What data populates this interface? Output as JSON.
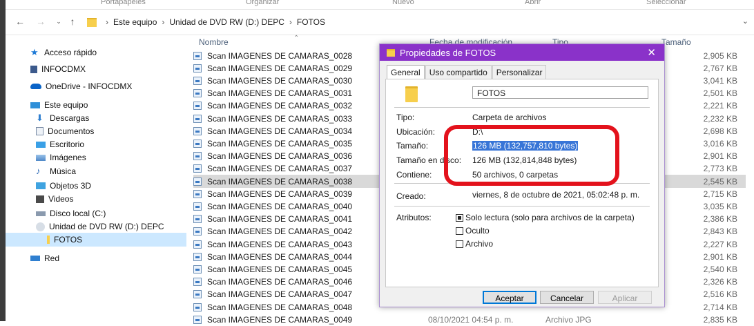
{
  "ribbon": [
    "Portapapeles",
    "Organizar",
    "Nuevo",
    "Abrir",
    "Seleccionar"
  ],
  "address": {
    "crumbs": [
      "Este equipo",
      "Unidad de DVD RW (D:) DEPC",
      "FOTOS"
    ]
  },
  "nav": [
    {
      "label": "Acceso rápido",
      "icon": "star-icon",
      "color": "#1e7ad6"
    },
    {
      "label": "INFOCDMX",
      "icon": "building-icon",
      "color": "#3c5a8c"
    },
    {
      "label": "OneDrive - INFOCDMX",
      "icon": "cloud-icon",
      "color": "#0a64c8"
    },
    {
      "label": "Este equipo",
      "icon": "computer-icon",
      "color": "#2f8fd8"
    },
    {
      "label": "Descargas",
      "icon": "download-icon",
      "color": "#2f7fd0"
    },
    {
      "label": "Documentos",
      "icon": "documents-icon",
      "color": "#7a8ca6"
    },
    {
      "label": "Escritorio",
      "icon": "desktop-icon",
      "color": "#3aa0e6"
    },
    {
      "label": "Imágenes",
      "icon": "pictures-icon",
      "color": "#4f88c8"
    },
    {
      "label": "Música",
      "icon": "music-icon",
      "color": "#1f5fb0"
    },
    {
      "label": "Objetos 3D",
      "icon": "objects-3d-icon",
      "color": "#3fa3e0"
    },
    {
      "label": "Videos",
      "icon": "videos-icon",
      "color": "#4a4a4a"
    },
    {
      "label": "Disco local (C:)",
      "icon": "disk-icon",
      "color": "#8a9aae"
    },
    {
      "label": "Unidad de DVD RW (D:) DEPC",
      "icon": "dvd-icon",
      "color": "#b9c4cf"
    },
    {
      "label": "FOTOS",
      "icon": "folder-icon",
      "color": "#f7cf4d"
    },
    {
      "label": "Red",
      "icon": "network-icon",
      "color": "#2f7fd0"
    }
  ],
  "list": {
    "columns": {
      "name": "Nombre",
      "date": "Fecha de modificación",
      "type": "Tipo",
      "size": "Tamaño"
    },
    "rows": [
      {
        "name": "Scan IMAGENES DE CAMARAS_0028",
        "size": "2,905 KB"
      },
      {
        "name": "Scan IMAGENES DE CAMARAS_0029",
        "size": "2,767 KB"
      },
      {
        "name": "Scan IMAGENES DE CAMARAS_0030",
        "size": "3,041 KB"
      },
      {
        "name": "Scan IMAGENES DE CAMARAS_0031",
        "size": "2,501 KB"
      },
      {
        "name": "Scan IMAGENES DE CAMARAS_0032",
        "size": "2,221 KB"
      },
      {
        "name": "Scan IMAGENES DE CAMARAS_0033",
        "size": "2,232 KB"
      },
      {
        "name": "Scan IMAGENES DE CAMARAS_0034",
        "size": "2,698 KB"
      },
      {
        "name": "Scan IMAGENES DE CAMARAS_0035",
        "size": "3,016 KB"
      },
      {
        "name": "Scan IMAGENES DE CAMARAS_0036",
        "size": "2,901 KB"
      },
      {
        "name": "Scan IMAGENES DE CAMARAS_0037",
        "size": "2,773 KB"
      },
      {
        "name": "Scan IMAGENES DE CAMARAS_0038",
        "size": "2,545 KB",
        "highlight": true
      },
      {
        "name": "Scan IMAGENES DE CAMARAS_0039",
        "size": "2,715 KB"
      },
      {
        "name": "Scan IMAGENES DE CAMARAS_0040",
        "size": "3,035 KB"
      },
      {
        "name": "Scan IMAGENES DE CAMARAS_0041",
        "size": "2,386 KB"
      },
      {
        "name": "Scan IMAGENES DE CAMARAS_0042",
        "size": "2,843 KB"
      },
      {
        "name": "Scan IMAGENES DE CAMARAS_0043",
        "size": "2,227 KB"
      },
      {
        "name": "Scan IMAGENES DE CAMARAS_0044",
        "size": "2,901 KB"
      },
      {
        "name": "Scan IMAGENES DE CAMARAS_0045",
        "size": "2,540 KB"
      },
      {
        "name": "Scan IMAGENES DE CAMARAS_0046",
        "size": "2,326 KB"
      },
      {
        "name": "Scan IMAGENES DE CAMARAS_0047",
        "size": "2,516 KB"
      },
      {
        "name": "Scan IMAGENES DE CAMARAS_0048",
        "size": "2,714 KB"
      },
      {
        "name": "Scan IMAGENES DE CAMARAS_0049",
        "date": "08/10/2021 04:54 p. m.",
        "type": "Archivo JPG",
        "size": "2,835 KB"
      }
    ]
  },
  "dialog": {
    "title": "Propiedades de FOTOS",
    "tabs": [
      "General",
      "Uso compartido",
      "Personalizar"
    ],
    "folder_name": "FOTOS",
    "props": {
      "tipo_label": "Tipo:",
      "tipo": "Carpeta de archivos",
      "ubicacion_label": "Ubicación:",
      "ubicacion": "D:\\",
      "tamano_label": "Tamaño:",
      "tamano": "126 MB (132,757,810 bytes)",
      "tamano_disco_label": "Tamaño en disco:",
      "tamano_disco": "126 MB (132,814,848 bytes)",
      "contiene_label": "Contiene:",
      "contiene": "50 archivos, 0 carpetas",
      "creado_label": "Creado:",
      "creado": "viernes, 8 de octubre de 2021, 05:02:48 p. m.",
      "atributos_label": "Atributos:"
    },
    "attributes": {
      "solo_lectura": "Solo lectura (solo para archivos de la carpeta)",
      "oculto": "Oculto",
      "archivo": "Archivo"
    },
    "buttons": {
      "ok": "Aceptar",
      "cancel": "Cancelar",
      "apply": "Aplicar"
    }
  },
  "colors": {
    "title_bar": "#8a32c9",
    "annotation": "#e3121c",
    "selection": "#3875d7"
  }
}
